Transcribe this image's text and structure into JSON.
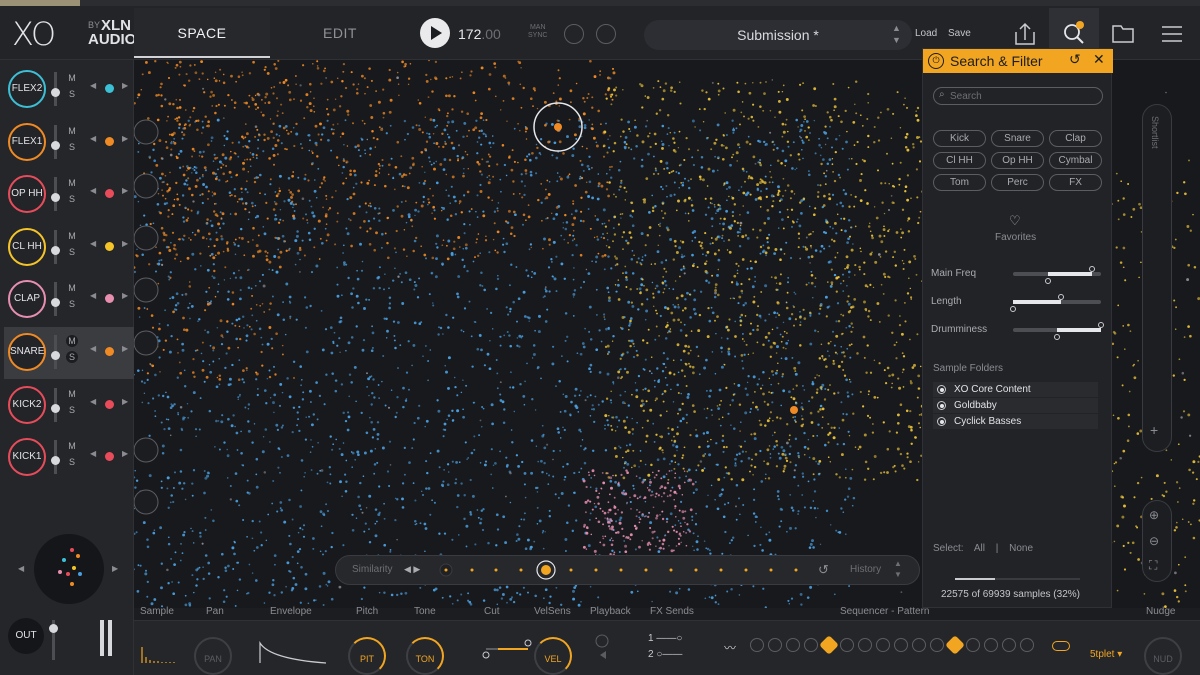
{
  "logo": {
    "mark": "XO",
    "by": "BY",
    "brand_line1": "XLN",
    "brand_line2": "AUDIO"
  },
  "tabs": [
    {
      "label": "SPACE",
      "active": true
    },
    {
      "label": "EDIT",
      "active": false
    }
  ],
  "transport": {
    "bpm_int": "172",
    "bpm_dec": ".00",
    "swing_line1": "MAN",
    "swing_line2": "SYNC"
  },
  "preset": {
    "name": "Submission *",
    "load_label": "Load",
    "save_label": "Save"
  },
  "toolbar_icons": [
    "share-icon",
    "search-filter-icon",
    "folder-icon",
    "menu-icon"
  ],
  "tracks": [
    {
      "name": "FLEX2",
      "color": "#3cc0d6",
      "mute": "M",
      "solo": "S",
      "selected": false
    },
    {
      "name": "FLEX1",
      "color": "#f08a24",
      "mute": "M",
      "solo": "S",
      "selected": false
    },
    {
      "name": "OP HH",
      "color": "#e84c5a",
      "mute": "M",
      "solo": "S",
      "selected": false
    },
    {
      "name": "CL HH",
      "color": "#f5c428",
      "mute": "M",
      "solo": "S",
      "selected": false
    },
    {
      "name": "CLAP",
      "color": "#e88fb0",
      "mute": "M",
      "solo": "S",
      "selected": false
    },
    {
      "name": "SNARE",
      "color": "#f08a24",
      "mute": "M",
      "solo": "S",
      "selected": true
    },
    {
      "name": "KICK2",
      "color": "#e84c5a",
      "mute": "M",
      "solo": "S",
      "selected": false
    },
    {
      "name": "KICK1",
      "color": "#e84c5a",
      "mute": "M",
      "solo": "S",
      "selected": false
    }
  ],
  "output": {
    "label": "OUT"
  },
  "similarity": {
    "label": "Similarity",
    "history_label": "History"
  },
  "shortlist": {
    "label": "Shortlist"
  },
  "search_filter": {
    "title": "Search & Filter",
    "search_placeholder": "Search",
    "categories": [
      "Kick",
      "Snare",
      "Clap",
      "Cl HH",
      "Op HH",
      "Cymbal",
      "Tom",
      "Perc",
      "FX"
    ],
    "favorites_label": "Favorites",
    "sliders": [
      {
        "label": "Main Freq",
        "low": 0.4,
        "high": 0.9
      },
      {
        "label": "Length",
        "low": 0.0,
        "high": 0.55
      },
      {
        "label": "Drumminess",
        "low": 0.5,
        "high": 1.0
      }
    ],
    "folders_label": "Sample Folders",
    "folders": [
      "XO Core Content",
      "Goldbaby",
      "Cyclick Basses"
    ],
    "select_label": "Select:",
    "select_all": "All",
    "select_sep": "|",
    "select_none": "None",
    "count_text": "22575 of 69939 samples (32%)",
    "count_fraction": 0.32
  },
  "bottom": {
    "labels": [
      "Sample",
      "Pan",
      "Envelope",
      "Pitch",
      "Tone",
      "Cut",
      "VelSens",
      "Playback",
      "FX Sends",
      "Sequencer - Pattern",
      "Nudge"
    ],
    "knobs": [
      "PAN",
      "PIT",
      "TON",
      "VEL",
      "NUD"
    ],
    "sends_line1": "1",
    "sends_line2": "2",
    "tuplet": "5tplet"
  },
  "colors": {
    "accent": "#f2a521",
    "blue_points": "#4a9fe0",
    "orange_points": "#f08a24",
    "yellow_points": "#e8c13a",
    "pink_points": "#e88fb0"
  }
}
